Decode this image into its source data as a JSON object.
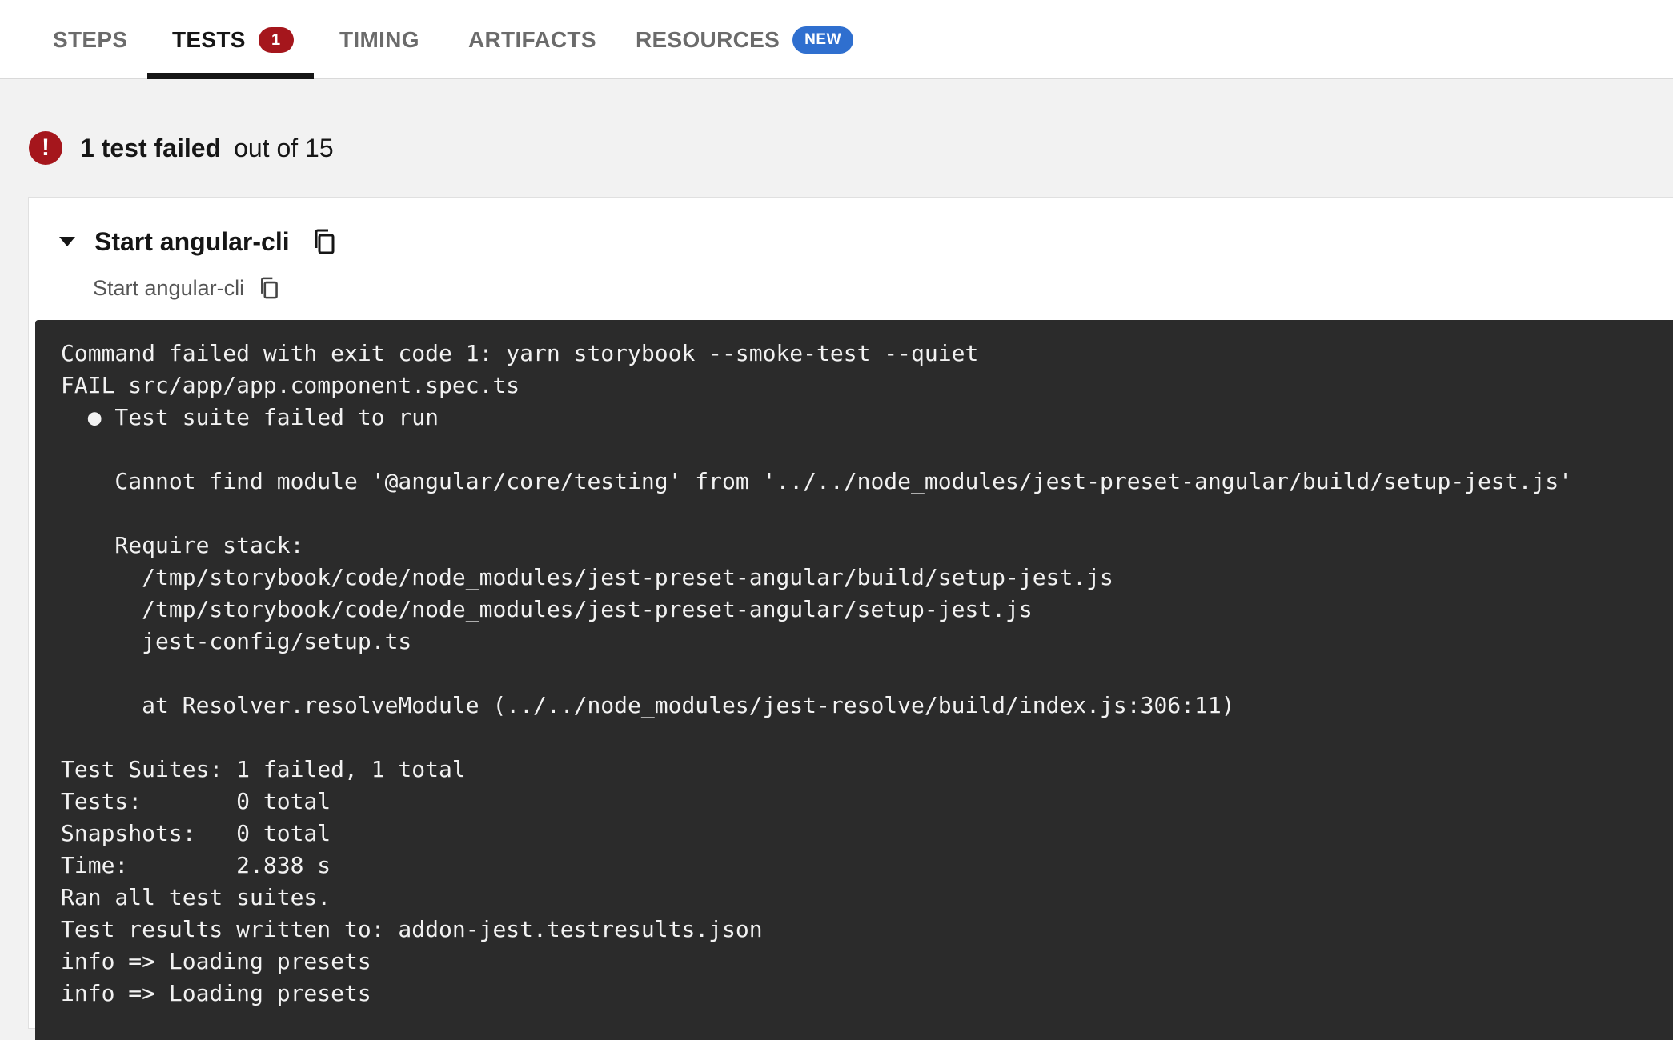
{
  "tabs": [
    {
      "label": "STEPS",
      "active": false
    },
    {
      "label": "TESTS",
      "active": true,
      "badge": "1"
    },
    {
      "label": "TIMING",
      "active": false
    },
    {
      "label": "ARTIFACTS",
      "active": false
    },
    {
      "label": "RESOURCES",
      "active": false,
      "badge": "NEW"
    }
  ],
  "summary": {
    "icon": "error-icon",
    "icon_glyph": "!",
    "failed_text": "1 test failed",
    "rest_text": "out of 15"
  },
  "test": {
    "title": "Start angular-cli",
    "subtitle": "Start angular-cli",
    "copy_icon": "copy-icon",
    "caret_icon": "caret-down-icon",
    "log_lines": [
      "Command failed with exit code 1: yarn storybook --smoke-test --quiet",
      "FAIL src/app/app.component.spec.ts",
      "  ● Test suite failed to run",
      "",
      "    Cannot find module '@angular/core/testing' from '../../node_modules/jest-preset-angular/build/setup-jest.js'",
      "",
      "    Require stack:",
      "      /tmp/storybook/code/node_modules/jest-preset-angular/build/setup-jest.js",
      "      /tmp/storybook/code/node_modules/jest-preset-angular/setup-jest.js",
      "      jest-config/setup.ts",
      "",
      "      at Resolver.resolveModule (../../node_modules/jest-resolve/build/index.js:306:11)",
      "",
      "Test Suites: 1 failed, 1 total",
      "Tests:       0 total",
      "Snapshots:   0 total",
      "Time:        2.838 s",
      "Ran all test suites.",
      "Test results written to: addon-jest.testresults.json",
      "info => Loading presets",
      "info => Loading presets"
    ]
  },
  "colors": {
    "error": "#a5161c",
    "new_badge": "#2f6fcf",
    "terminal_bg": "#2b2b2b",
    "page_bg": "#f2f2f2"
  }
}
